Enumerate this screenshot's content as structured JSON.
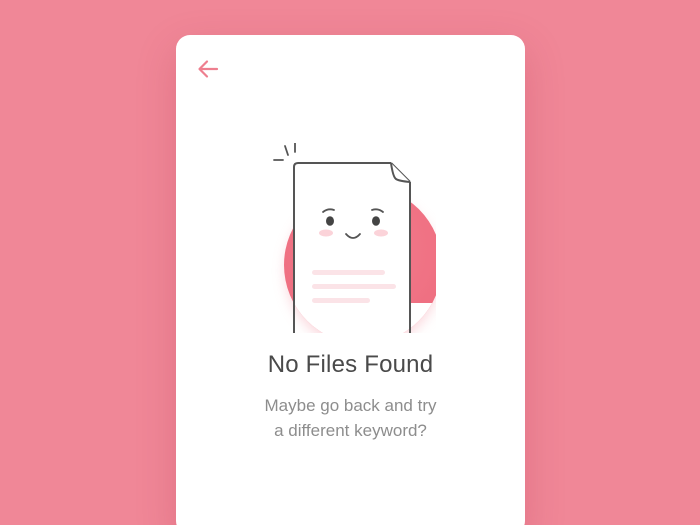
{
  "colors": {
    "background": "#f08797",
    "card": "#ffffff",
    "accent": "#ee7f8f",
    "title": "#4a4a4a",
    "subtitle": "#8d8d8d"
  },
  "header": {
    "back_icon": "arrow-left-icon"
  },
  "empty_state": {
    "illustration": "sad-document-icon",
    "title": "No Files Found",
    "message_line1": "Maybe go back and try",
    "message_line2": "a different keyword?"
  }
}
